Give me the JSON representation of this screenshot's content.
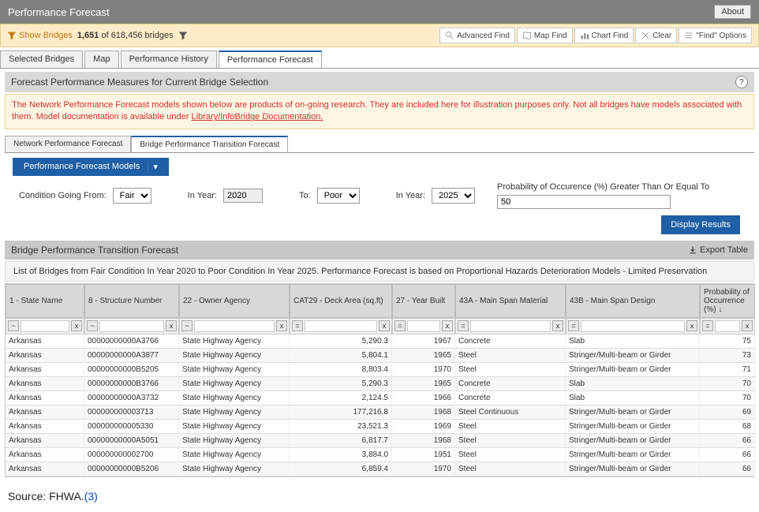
{
  "titlebar": {
    "title": "Performance Forecast",
    "about": "About"
  },
  "filterbar": {
    "show_bridges": "Show Bridges",
    "count_bold": "1,651",
    "count_rest": " of 618,456 bridges",
    "buttons": {
      "advanced": "Advanced Find",
      "mapfind": "Map Find",
      "chartfind": "Chart Find",
      "clear": "Clear",
      "findoptions": "\"Find\" Options"
    }
  },
  "maintabs": [
    "Selected Bridges",
    "Map",
    "Performance History",
    "Performance Forecast"
  ],
  "maintabs_active": 3,
  "section_title": "Forecast Performance Measures for Current Bridge Selection",
  "warning_text": "The Network Performance Forecast models shown below are products of on-going research. They are included here for illustration purposes only. Not all bridges have models associated with them. Model documentation is available under ",
  "warning_link": "Library/InfoBridge Documentation.",
  "subtabs": [
    "Network Performance Forecast",
    "Bridge Performance Transition Forecast"
  ],
  "subtabs_active": 1,
  "models_btn": "Performance Forecast Models",
  "controls": {
    "going_from": "Condition Going From:",
    "cond_from": "Fair",
    "in_year1": "In Year:",
    "year_from": "2020",
    "to": "To:",
    "cond_to": "Poor",
    "in_year2": "In Year:",
    "year_to": "2025",
    "prob_label": "Probability of Occurence (%) Greater Than Or Equal To",
    "prob_val": "50",
    "display": "Display Results"
  },
  "sub_header": "Bridge Performance Transition Forecast",
  "export": "Export Table",
  "list_desc": "List of Bridges from Fair Condition In Year 2020 to Poor Condition In Year 2025. Performance Forecast is based on Proportional Hazards Deterioration Models - Limited Preservation",
  "columns": [
    "1 - State Name",
    "8 - Structure Number",
    "22 - Owner Agency",
    "CAT29 - Deck Area (sq.ft)",
    "27 - Year Built",
    "43A - Main Span Material",
    "43B - Main Span Design",
    "Probability of Occurrence (%) ↓"
  ],
  "rows": [
    [
      "Arkansas",
      "00000000000A3766",
      "State Highway Agency",
      "5,290.3",
      "1967",
      "Concrete",
      "Slab",
      "75"
    ],
    [
      "Arkansas",
      "00000000000A3877",
      "State Highway Agency",
      "5,804.1",
      "1965",
      "Steel",
      "Stringer/Multi-beam or Girder",
      "73"
    ],
    [
      "Arkansas",
      "00000000000B5205",
      "State Highway Agency",
      "8,803.4",
      "1970",
      "Steel",
      "Stringer/Multi-beam or Girder",
      "71"
    ],
    [
      "Arkansas",
      "00000000000B3766",
      "State Highway Agency",
      "5,290.3",
      "1965",
      "Concrete",
      "Slab",
      "70"
    ],
    [
      "Arkansas",
      "00000000000A3732",
      "State Highway Agency",
      "2,124.5",
      "1966",
      "Concrete",
      "Slab",
      "70"
    ],
    [
      "Arkansas",
      "000000000003713",
      "State Highway Agency",
      "177,216.8",
      "1968",
      "Steel Continuous",
      "Stringer/Multi-beam or Girder",
      "69"
    ],
    [
      "Arkansas",
      "000000000005330",
      "State Highway Agency",
      "23,521.3",
      "1969",
      "Steel",
      "Stringer/Multi-beam or Girder",
      "68"
    ],
    [
      "Arkansas",
      "00000000000A5051",
      "State Highway Agency",
      "6,817.7",
      "1968",
      "Steel",
      "Stringer/Multi-beam or Girder",
      "66"
    ],
    [
      "Arkansas",
      "000000000002700",
      "State Highway Agency",
      "3,884.0",
      "1951",
      "Steel",
      "Stringer/Multi-beam or Girder",
      "66"
    ],
    [
      "Arkansas",
      "00000000000B5206",
      "State Highway Agency",
      "6,859.4",
      "1970",
      "Steel",
      "Stringer/Multi-beam or Girder",
      "66"
    ]
  ],
  "source": {
    "label": "Source: FHWA.",
    "ref": "(3)"
  }
}
